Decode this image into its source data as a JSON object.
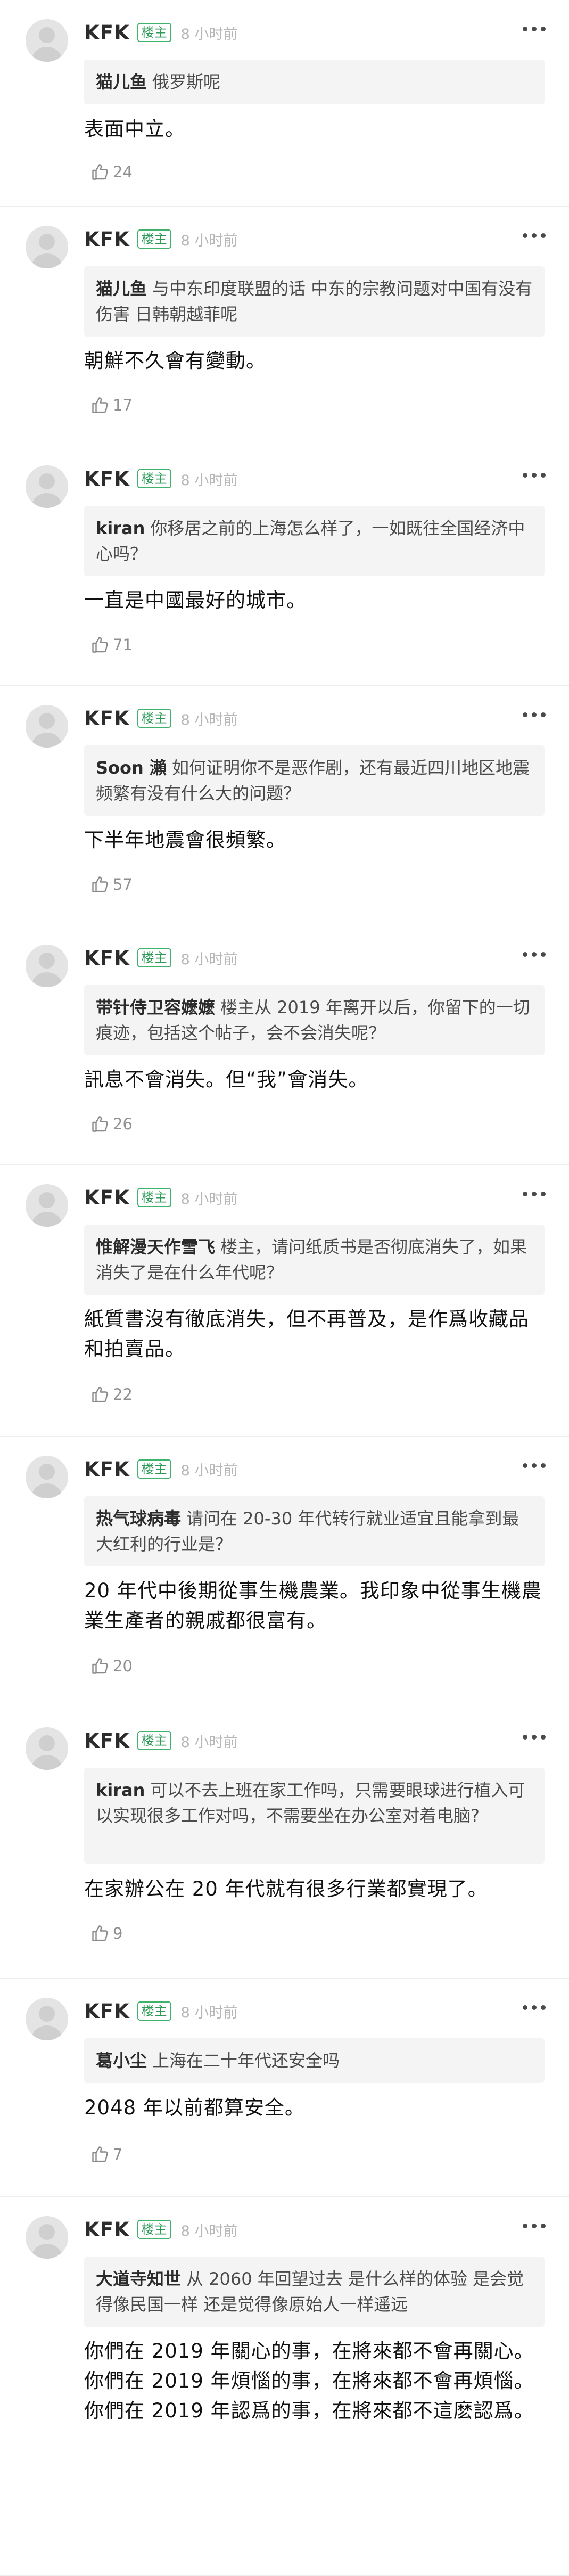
{
  "comments": [
    {
      "author": "KFK",
      "badge": "楼主",
      "time": "8 小时前",
      "quote_user": "猫儿鱼",
      "quote_text": "俄罗斯呢",
      "reply": "表面中立。",
      "likes": "24"
    },
    {
      "author": "KFK",
      "badge": "楼主",
      "time": "8 小时前",
      "quote_user": "猫儿鱼",
      "quote_text": "与中东印度联盟的话 中东的宗教问题对中国有没有伤害 日韩朝越菲呢",
      "reply": "朝鮮不久會有變動。",
      "likes": "17"
    },
    {
      "author": "KFK",
      "badge": "楼主",
      "time": "8 小时前",
      "quote_user": "kiran",
      "quote_text": "你移居之前的上海怎么样了，一如既往全国经济中心吗？",
      "reply": "一直是中國最好的城市。",
      "likes": "71"
    },
    {
      "author": "KFK",
      "badge": "楼主",
      "time": "8 小时前",
      "quote_user": "Soon 瀨",
      "quote_text": "如何证明你不是恶作剧，还有最近四川地区地震频繁有没有什么大的问题？",
      "reply": "下半年地震會很頻繁。",
      "likes": "57"
    },
    {
      "author": "KFK",
      "badge": "楼主",
      "time": "8 小时前",
      "quote_user": "带针侍卫容嬷嬷",
      "quote_text": "楼主从 2019 年离开以后，你留下的一切痕迹，包括这个帖子，会不会消失呢？",
      "reply": "訊息不會消失。但“我”會消失。",
      "likes": "26"
    },
    {
      "author": "KFK",
      "badge": "楼主",
      "time": "8 小时前",
      "quote_user": "惟解漫天作雪飞",
      "quote_text": "楼主，请问纸质书是否彻底消失了，如果消失了是在什么年代呢？",
      "reply": "紙質書沒有徹底消失，但不再普及，是作爲收藏品和拍賣品。",
      "likes": "22"
    },
    {
      "author": "KFK",
      "badge": "楼主",
      "time": "8 小时前",
      "quote_user": "热气球病毒",
      "quote_text": "请问在 20-30 年代转行就业适宜且能拿到最大红利的行业是？",
      "reply": "20 年代中後期從事生機農業。我印象中從事生機農業生產者的親戚都很富有。",
      "likes": "20"
    },
    {
      "author": "KFK",
      "badge": "楼主",
      "time": "8 小时前",
      "quote_user": "kiran",
      "quote_text": "可以不去上班在家工作吗，只需要眼球进行植入可以实现很多工作对吗，不需要坐在办公室对着电脑?",
      "reply": "在家辦公在 20 年代就有很多行業都實現了。",
      "likes": "9"
    },
    {
      "author": "KFK",
      "badge": "楼主",
      "time": "8 小时前",
      "quote_user": "葛小尘",
      "quote_text": "上海在二十年代还安全吗",
      "reply": "2048 年以前都算安全。",
      "likes": "7"
    },
    {
      "author": "KFK",
      "badge": "楼主",
      "time": "8 小时前",
      "quote_user": "大道寺知世",
      "quote_text": "从 2060 年回望过去 是什么样的体验 是会觉得像民国一样 还是觉得像原始人一样遥远",
      "reply": "你們在 2019 年關心的事，在將來都不會再關心。\n你們在 2019 年煩惱的事，在將來都不會再煩惱。\n你們在 2019 年認爲的事，在將來都不這麽認爲。",
      "likes": ""
    }
  ]
}
